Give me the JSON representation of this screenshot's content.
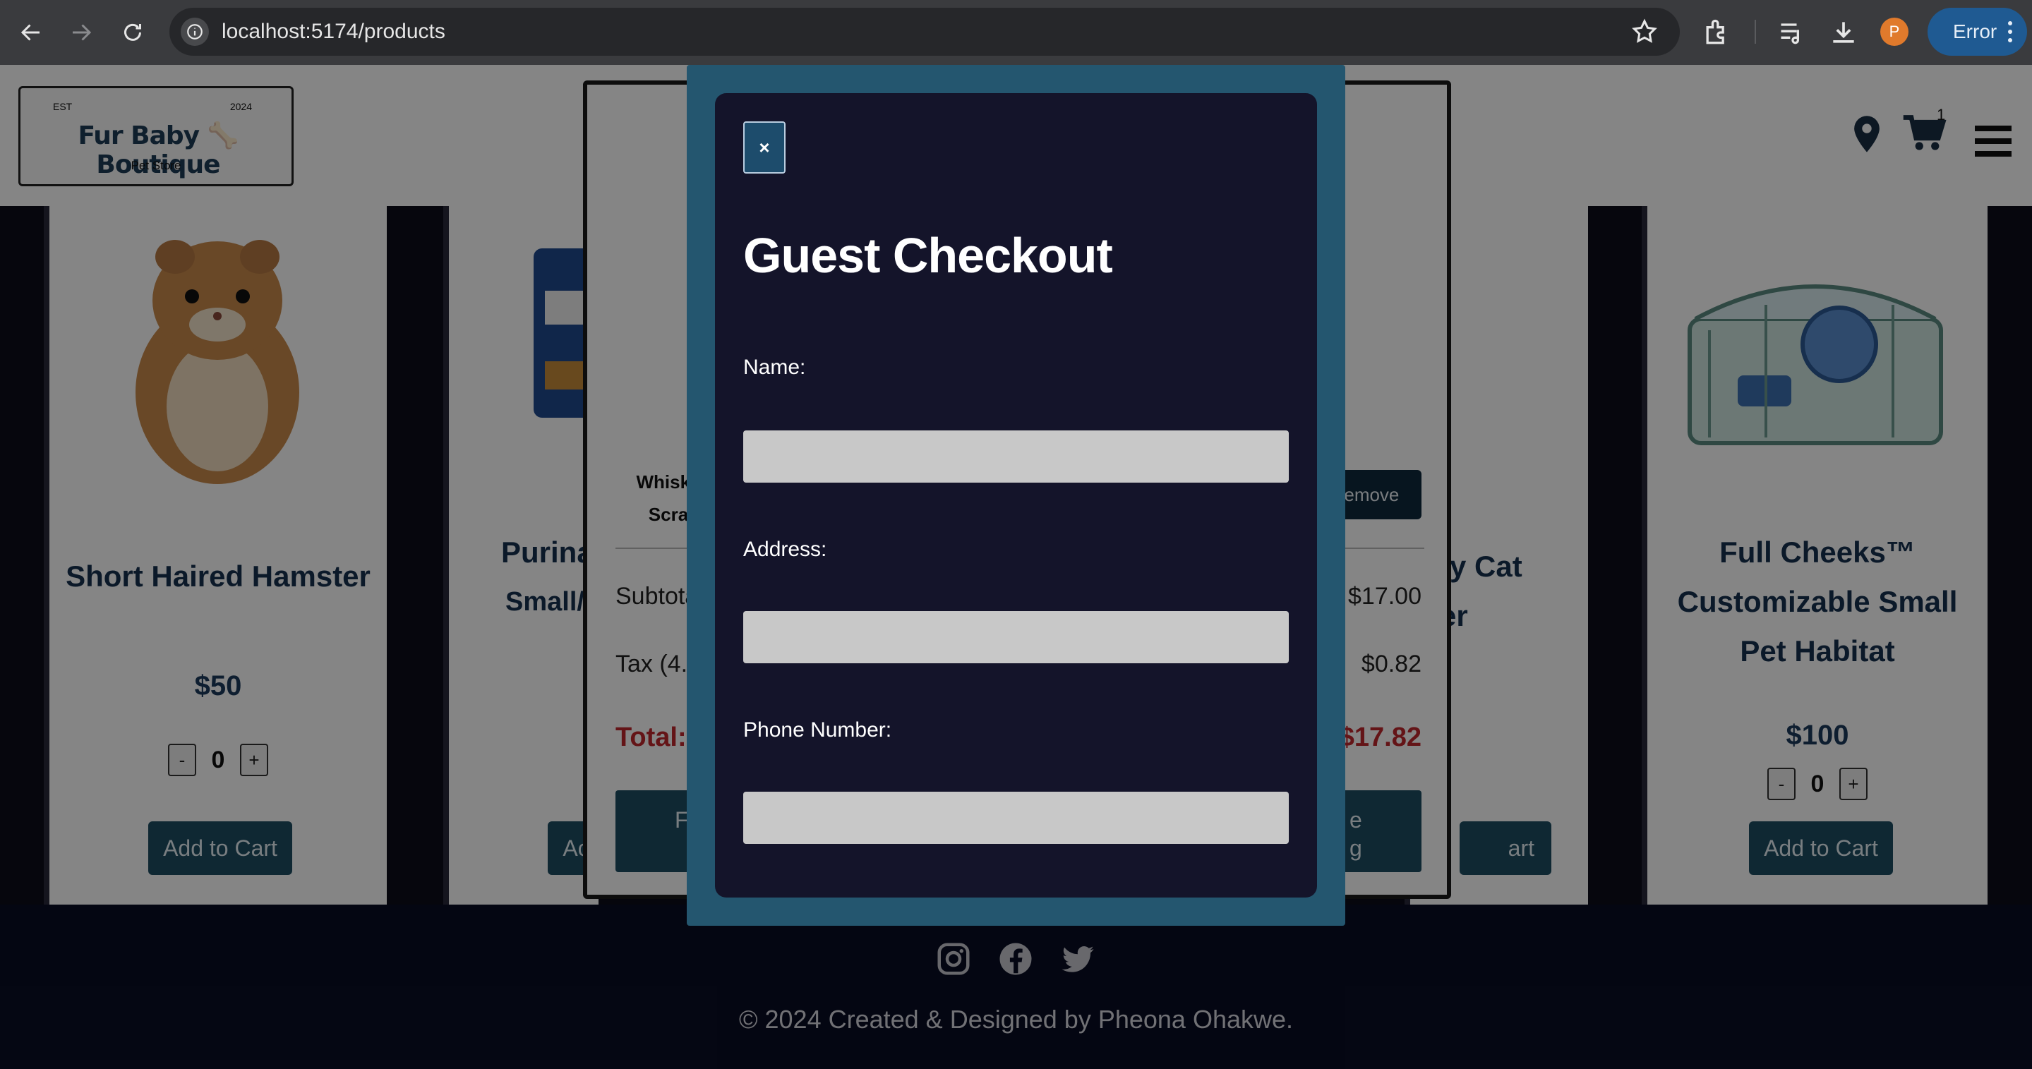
{
  "browser": {
    "url": "localhost:5174/products",
    "profile_initial": "P",
    "error_label": "Error"
  },
  "header": {
    "logo_est": "EST",
    "logo_year": "2024",
    "logo_text": "Fur Baby 🦴 Boutique",
    "logo_sub": "Pet Store",
    "cart_count": "1"
  },
  "products": [
    {
      "title_lines": [
        "Short Haired Hamster"
      ],
      "price": "$50",
      "qty": "0",
      "add_label": "Add to Cart"
    },
    {
      "title_lines": [
        "Purina®",
        "Small/I"
      ],
      "price": "",
      "qty": "",
      "add_label": "Ac"
    },
    {
      "title_lines": [
        "ty Cat",
        "er"
      ],
      "price": "",
      "qty": "",
      "add_label": "art"
    },
    {
      "title_lines": [
        "Full Cheeks™",
        "Customizable Small",
        "Pet Habitat"
      ],
      "price": "$100",
      "qty": "0",
      "add_label": "Add to Cart"
    }
  ],
  "cart": {
    "item_name": "Whiske Scra",
    "remove_label": "Remove",
    "subtotal_label": "Subtota",
    "subtotal_value": "$17.00",
    "tax_label": "Tax (4.8",
    "tax_value": "$0.82",
    "total_label": "Total:",
    "total_value": "$17.82",
    "left_button": "F",
    "right_button_line1": "e",
    "right_button_line2": "g"
  },
  "checkout": {
    "close_label": "×",
    "title": "Guest Checkout",
    "name_label": "Name:",
    "name_value": "",
    "address_label": "Address:",
    "address_value": "",
    "phone_label": "Phone Number:",
    "phone_value": ""
  },
  "footer": {
    "copyright": "© 2024 Created & Designed by Pheona Ohakwe.",
    "social": [
      "instagram-icon",
      "facebook-icon",
      "twitter-icon"
    ]
  }
}
